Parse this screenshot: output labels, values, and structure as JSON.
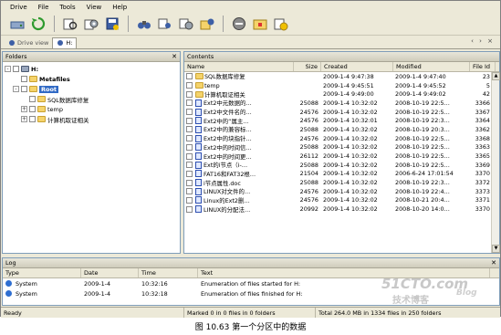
{
  "menu": [
    "Drive",
    "File",
    "Tools",
    "View",
    "Help"
  ],
  "tabs": [
    "Drive view",
    "H:"
  ],
  "folders": {
    "title": "Folders",
    "items": [
      {
        "label": "H:",
        "level": 0,
        "expander": "-"
      },
      {
        "label": "Metafiles",
        "level": 1,
        "expander": ""
      },
      {
        "label": "Root",
        "level": 1,
        "expander": "-",
        "selected": true
      },
      {
        "label": "SQL数据库修复",
        "level": 2,
        "expander": ""
      },
      {
        "label": "temp",
        "level": 2,
        "expander": "+"
      },
      {
        "label": "计算机取证相关",
        "level": 2,
        "expander": "+"
      }
    ]
  },
  "contents": {
    "title": "Contents",
    "columns": [
      "Name",
      "Size",
      "Created",
      "Modified",
      "File Id"
    ],
    "rows": [
      {
        "name": "SQL数据库修复",
        "size": "",
        "created": "2009-1-4 9:47:38",
        "modified": "2009-1-4 9:47:40",
        "id": "23",
        "folder": true
      },
      {
        "name": "temp",
        "size": "",
        "created": "2009-1-4 9:45:51",
        "modified": "2009-1-4 9:45:52",
        "id": "5",
        "folder": true
      },
      {
        "name": "计算机取证相关",
        "size": "",
        "created": "2009-1-4 9:49:00",
        "modified": "2009-1-4 9:49:02",
        "id": "42",
        "folder": true
      },
      {
        "name": "Ext2中元数据的…",
        "size": "25088",
        "created": "2009-1-4 10:32:02",
        "modified": "2008-10-19 22:5…",
        "id": "3366"
      },
      {
        "name": "Ext2中文件名的…",
        "size": "24576",
        "created": "2009-1-4 10:32:02",
        "modified": "2008-10-19 22:5…",
        "id": "3367"
      },
      {
        "name": "Ext2中的“属主…",
        "size": "24576",
        "created": "2009-1-4 10:32:01",
        "modified": "2008-10-19 22:3…",
        "id": "3364"
      },
      {
        "name": "Ext2中的兼容标…",
        "size": "25088",
        "created": "2009-1-4 10:32:02",
        "modified": "2008-10-19 20:3…",
        "id": "3362"
      },
      {
        "name": "Ext2中的块指针…",
        "size": "24576",
        "created": "2009-1-4 10:32:02",
        "modified": "2008-10-19 22:5…",
        "id": "3368"
      },
      {
        "name": "Ext2中的时间信…",
        "size": "25088",
        "created": "2009-1-4 10:32:02",
        "modified": "2008-10-19 22:5…",
        "id": "3363"
      },
      {
        "name": "Ext2中的时间更…",
        "size": "26112",
        "created": "2009-1-4 10:32:02",
        "modified": "2008-10-19 22:5…",
        "id": "3365"
      },
      {
        "name": "Ext的i节点（i-…",
        "size": "25088",
        "created": "2009-1-4 10:32:02",
        "modified": "2008-10-19 22:5…",
        "id": "3369"
      },
      {
        "name": "FAT16和FAT32根…",
        "size": "21504",
        "created": "2009-1-4 10:32:02",
        "modified": "2006-6-24 17:01:54",
        "id": "3370"
      },
      {
        "name": "i节点属性.doc",
        "size": "25088",
        "created": "2009-1-4 10:32:02",
        "modified": "2008-10-19 22:3…",
        "id": "3372"
      },
      {
        "name": "LINUX对文件的…",
        "size": "24576",
        "created": "2009-1-4 10:32:02",
        "modified": "2008-10-19 22:4…",
        "id": "3373"
      },
      {
        "name": "Linux的Ext2删…",
        "size": "24576",
        "created": "2009-1-4 10:32:02",
        "modified": "2008-10-21 20:4…",
        "id": "3371"
      },
      {
        "name": "LINUX的分配法…",
        "size": "20992",
        "created": "2009-1-4 10:32:02",
        "modified": "2008-10-20 14:0…",
        "id": "3370"
      }
    ]
  },
  "log": {
    "title": "Log",
    "columns": [
      "Type",
      "Date",
      "Time",
      "Text"
    ],
    "rows": [
      {
        "type": "System",
        "date": "2009-1-4",
        "time": "10:32:16",
        "text": "Enumeration of files started for H:"
      },
      {
        "type": "System",
        "date": "2009-1-4",
        "time": "10:32:18",
        "text": "Enumeration of files finished for H:"
      }
    ]
  },
  "status": {
    "ready": "Ready",
    "marked": "Marked 0 in 0 files in 0 folders",
    "total": "Total 264.0 MB in 1334 files in 250 folders"
  },
  "caption": "图 10.63    第一个分区中的数据",
  "watermark": {
    "line1": "51CTO.com",
    "line2": "技术博客",
    "line3": "Blog"
  }
}
